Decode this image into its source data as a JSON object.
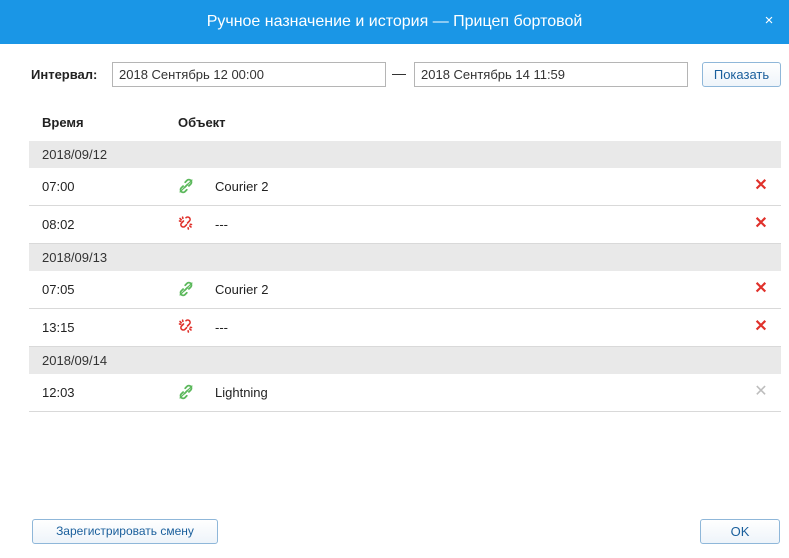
{
  "dialog": {
    "title": "Ручное назначение и история — Прицеп бортовой",
    "close_glyph": "×"
  },
  "interval": {
    "label": "Интервал:",
    "from": "2018 Сентябрь 12 00:00",
    "separator": "—",
    "to": "2018 Сентябрь 14 11:59",
    "show_button": "Показать"
  },
  "columns": {
    "time": "Время",
    "object": "Объект"
  },
  "icons": {
    "linked": {
      "name": "link-icon",
      "color": "#5cb85c"
    },
    "unlinked": {
      "name": "broken-link-icon",
      "color": "#e0312b"
    },
    "delete_active_color": "#e0312b",
    "delete_disabled_color": "#bdbdbd"
  },
  "groups": [
    {
      "date": "2018/09/12",
      "entries": [
        {
          "time": "07:00",
          "status": "linked",
          "object": "Courier 2",
          "delete": "✕",
          "deletable": true
        },
        {
          "time": "08:02",
          "status": "unlinked",
          "object": "---",
          "delete": "✕",
          "deletable": true
        }
      ]
    },
    {
      "date": "2018/09/13",
      "entries": [
        {
          "time": "07:05",
          "status": "linked",
          "object": "Courier 2",
          "delete": "✕",
          "deletable": true
        },
        {
          "time": "13:15",
          "status": "unlinked",
          "object": "---",
          "delete": "✕",
          "deletable": true
        }
      ]
    },
    {
      "date": "2018/09/14",
      "entries": [
        {
          "time": "12:03",
          "status": "linked",
          "object": "Lightning",
          "delete": "✕",
          "deletable": false
        }
      ]
    }
  ],
  "footer": {
    "register_button": "Зарегистрировать смену",
    "ok_button": "OK"
  }
}
